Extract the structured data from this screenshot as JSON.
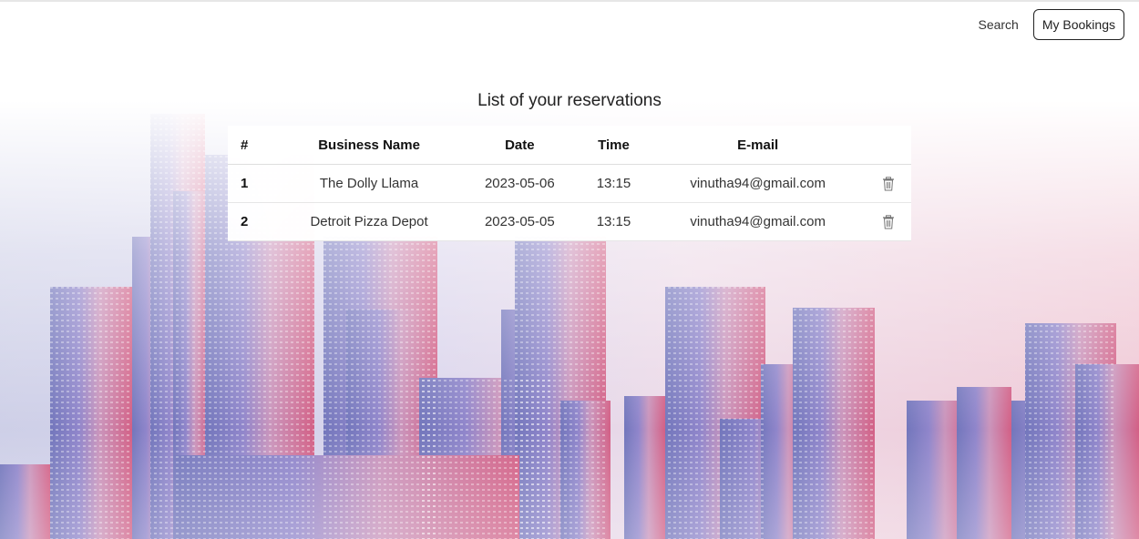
{
  "nav": {
    "search_label": "Search",
    "bookings_label": "My Bookings"
  },
  "page": {
    "title": "List of your reservations"
  },
  "table": {
    "headers": {
      "num": "#",
      "name": "Business Name",
      "date": "Date",
      "time": "Time",
      "email": "E-mail"
    },
    "rows": [
      {
        "num": "1",
        "name": "The Dolly Llama",
        "date": "2023-05-06",
        "time": "13:15",
        "email": "vinutha94@gmail.com"
      },
      {
        "num": "2",
        "name": "Detroit Pizza Depot",
        "date": "2023-05-05",
        "time": "13:15",
        "email": "vinutha94@gmail.com"
      }
    ]
  },
  "icons": {
    "delete": "trash-icon"
  },
  "colors": {
    "background_left": "#6b6fb8",
    "background_right": "#d0577f",
    "button_border": "#222222"
  }
}
